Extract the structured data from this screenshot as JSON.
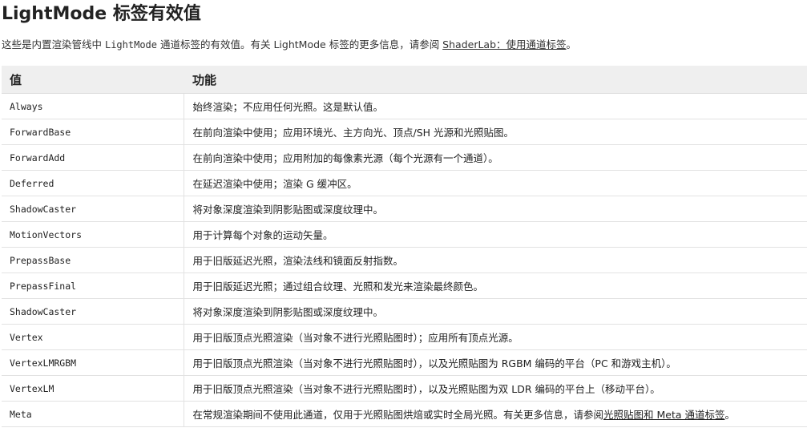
{
  "heading": "LightMode 标签有效值",
  "intro": {
    "prefix": "这些是内置渲染管线中 ",
    "code": "LightMode",
    "middle": " 通道标签的有效值。有关 LightMode 标签的更多信息，请参阅 ",
    "link": "ShaderLab：使用通道标签",
    "suffix": "。"
  },
  "table": {
    "headers": [
      "值",
      "功能"
    ],
    "rows": [
      {
        "value": "Always",
        "desc": "始终渲染；不应用任何光照。这是默认值。"
      },
      {
        "value": "ForwardBase",
        "desc": "在前向渲染中使用；应用环境光、主方向光、顶点/SH 光源和光照贴图。"
      },
      {
        "value": "ForwardAdd",
        "desc": "在前向渲染中使用；应用附加的每像素光源（每个光源有一个通道）。"
      },
      {
        "value": "Deferred",
        "desc": "在延迟渲染中使用；渲染 G 缓冲区。"
      },
      {
        "value": "ShadowCaster",
        "desc": "将对象深度渲染到阴影贴图或深度纹理中。"
      },
      {
        "value": "MotionVectors",
        "desc": "用于计算每个对象的运动矢量。"
      },
      {
        "value": "PrepassBase",
        "desc": "用于旧版延迟光照，渲染法线和镜面反射指数。"
      },
      {
        "value": "PrepassFinal",
        "desc": "用于旧版延迟光照；通过组合纹理、光照和发光来渲染最终颜色。"
      },
      {
        "value": "ShadowCaster",
        "desc": "将对象深度渲染到阴影贴图或深度纹理中。"
      },
      {
        "value": "Vertex",
        "desc": "用于旧版顶点光照渲染（当对象不进行光照贴图时）；应用所有顶点光源。"
      },
      {
        "value": "VertexLMRGBM",
        "desc": "用于旧版顶点光照渲染（当对象不进行光照贴图时），以及光照贴图为 RGBM 编码的平台（PC 和游戏主机）。"
      },
      {
        "value": "VertexLM",
        "desc": "用于旧版顶点光照渲染（当对象不进行光照贴图时），以及光照贴图为双 LDR 编码的平台上（移动平台）。"
      }
    ],
    "meta_row": {
      "value": "Meta",
      "desc_prefix": "在常规渲染期间不使用此通道，仅用于光照贴图烘焙或实时全局光照。有关更多信息，请参阅",
      "desc_link": "光照贴图和 Meta 通道标签",
      "desc_suffix": "。"
    }
  }
}
